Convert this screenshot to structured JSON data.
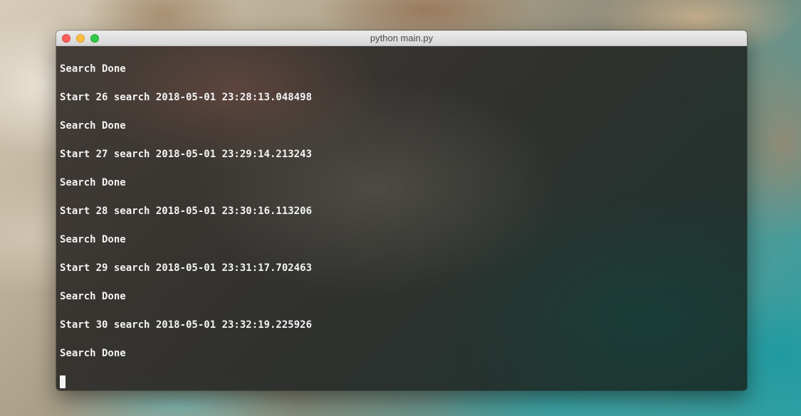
{
  "window": {
    "title": "python main.py",
    "controls": {
      "close": "close-button",
      "minimize": "minimize-button",
      "zoom": "zoom-button"
    }
  },
  "terminal": {
    "lines": [
      "Search Done",
      "Start 26 search 2018-05-01 23:28:13.048498",
      "Search Done",
      "Start 27 search 2018-05-01 23:29:14.213243",
      "Search Done",
      "Start 28 search 2018-05-01 23:30:16.113206",
      "Search Done",
      "Start 29 search 2018-05-01 23:31:17.702463",
      "Search Done",
      "Start 30 search 2018-05-01 23:32:19.225926",
      "Search Done"
    ]
  },
  "colors": {
    "text": "#f4f4f4",
    "close": "#fc605c",
    "minimize": "#fdbc40",
    "zoom": "#34c84a"
  }
}
